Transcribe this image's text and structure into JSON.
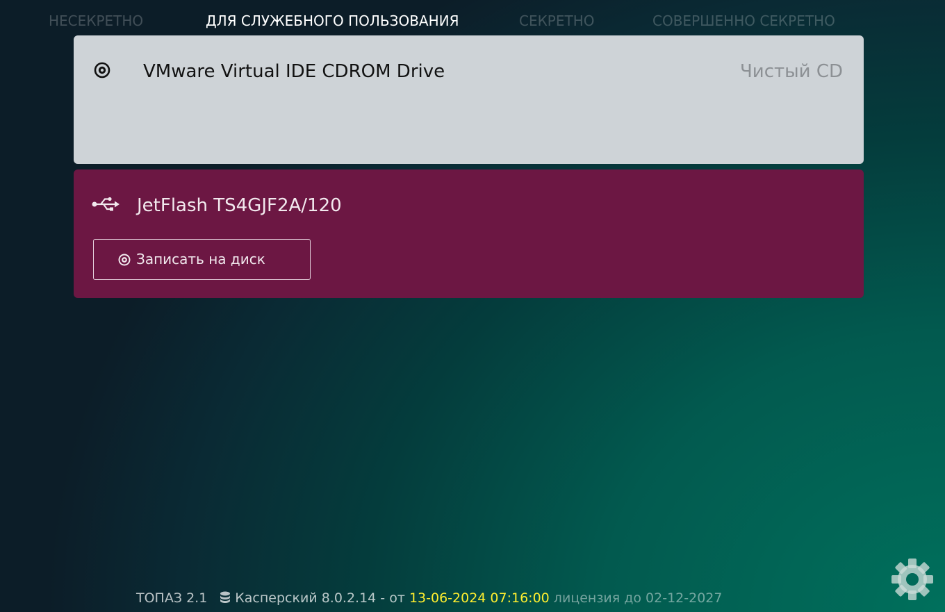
{
  "classification_tabs": [
    {
      "label": "НЕСЕКРЕТНО",
      "active": false
    },
    {
      "label": "ДЛЯ СЛУЖЕБНОГО ПОЛЬЗОВАНИЯ",
      "active": true
    },
    {
      "label": "СЕКРЕТНО",
      "active": false
    },
    {
      "label": "СОВЕРШЕННО СЕКРЕТНО",
      "active": false
    }
  ],
  "devices": {
    "cd": {
      "icon": "disc-icon",
      "name": "VMware Virtual IDE CDROM Drive",
      "status": "Чистый CD",
      "background": "#ced3d7"
    },
    "usb": {
      "icon": "usb-icon",
      "name": "JetFlash TS4GJF2A/120",
      "action_label": "Записать на диск",
      "action_icon": "disc-icon",
      "background": "#6c1743"
    }
  },
  "status_bar": {
    "app_version": "ТОПАЗ 2.1",
    "db_icon": "database-icon",
    "av_version": "Касперский 8.0.2.14 - от",
    "av_date": "13-06-2024 07:16:00",
    "license_text": "лицензия до 02-12-2027",
    "highlight_color": "#ffee2e"
  },
  "settings_icon": "gear-icon"
}
